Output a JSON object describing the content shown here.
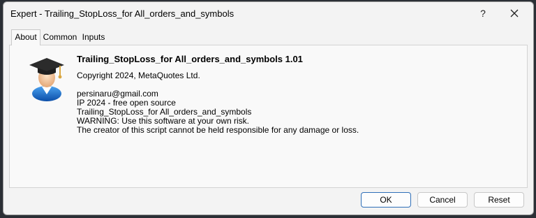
{
  "window": {
    "title": "Expert - Trailing_StopLoss_for All_orders_and_symbols",
    "help_label": "?"
  },
  "tabs": [
    {
      "label": "About"
    },
    {
      "label": "Common"
    },
    {
      "label": "Inputs"
    }
  ],
  "about": {
    "icon": "graduate-user-icon",
    "name": "Trailing_StopLoss_for All_orders_and_symbols 1.01",
    "copyright": "Copyright 2024, MetaQuotes Ltd.",
    "lines": [
      "persinaru@gmail.com",
      "IP 2024 - free open source",
      "Trailing_StopLoss_for All_orders_and_symbols",
      "WARNING: Use this software at your own risk.",
      "The creator of this script cannot be held responsible for any damage or loss."
    ]
  },
  "buttons": {
    "ok": "OK",
    "cancel": "Cancel",
    "reset": "Reset"
  },
  "colors": {
    "dialog_bg": "#f3f3f3",
    "panel_bg": "#f9f9f9",
    "primary_border": "#2f6fb8"
  }
}
